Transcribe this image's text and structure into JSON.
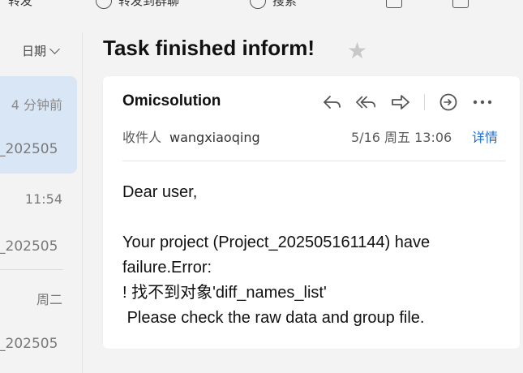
{
  "toolbar": {
    "reply_label": "转发",
    "forward_label": "转发到群聊",
    "search_label": "搜索"
  },
  "list": {
    "sort_label": "日期",
    "items": [
      {
        "time": "4 分钟前",
        "sub": "_202505",
        "selected": true
      },
      {
        "time": "11:54",
        "sub": "_202505",
        "selected": false
      },
      {
        "time": "周二",
        "sub": "_202505",
        "selected": false
      }
    ]
  },
  "message": {
    "subject": "Task finished inform!",
    "sender": "Omicsolution",
    "recipient_label": "收件人",
    "recipient": "wangxiaoqing",
    "date": "5/16 周五 13:06",
    "details_label": "详情",
    "body": {
      "greeting": "Dear user,",
      "line1": "Your project (Project_202505161144) have failure.Error:",
      "line2": "! 找不到对象'diff_names_list'",
      "line3": " Please check the raw data and group file."
    }
  },
  "icons": {
    "reply": "reply-icon",
    "reply_all": "reply-all-icon",
    "forward": "forward-icon",
    "comment": "comment-icon",
    "more": "more-icon",
    "star": "star-icon"
  },
  "colors": {
    "link": "#1a6fd1",
    "selected_bg": "#d9e6f6",
    "star": "#c8c8c8"
  }
}
